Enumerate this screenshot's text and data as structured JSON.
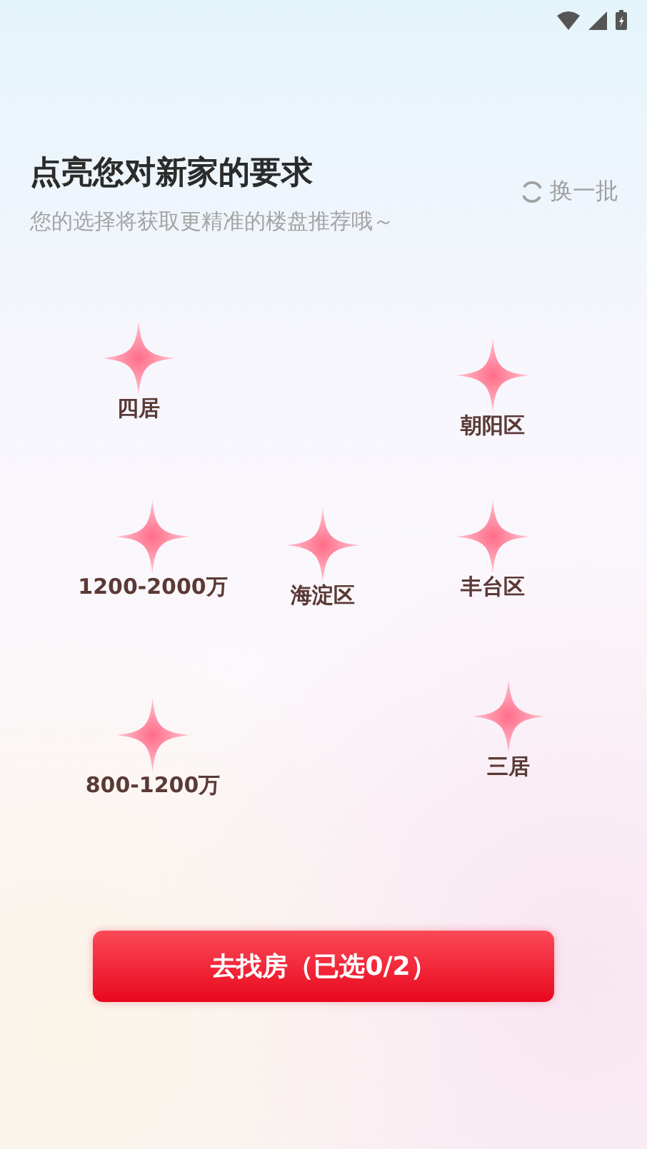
{
  "header": {
    "title": "点亮您对新家的要求",
    "subtitle": "您的选择将获取更精准的楼盘推荐哦～",
    "refresh": "换一批"
  },
  "options": [
    {
      "label": "四居",
      "selected": false
    },
    {
      "label": "朝阳区",
      "selected": false
    },
    {
      "label": "1200-2000万",
      "selected": false
    },
    {
      "label": "海淀区",
      "selected": false
    },
    {
      "label": "丰台区",
      "selected": false
    },
    {
      "label": "800-1200万",
      "selected": false
    },
    {
      "label": "三居",
      "selected": false
    }
  ],
  "submit": "去找房（已选0/2）"
}
